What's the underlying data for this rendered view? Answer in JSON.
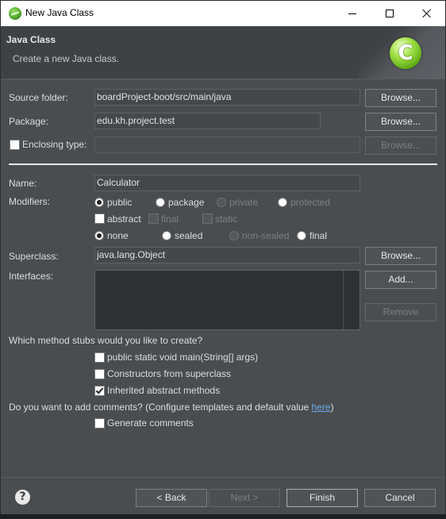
{
  "window": {
    "title": "New Java Class",
    "minimize_label": "",
    "maximize_label": "",
    "close_label": ""
  },
  "header": {
    "title": "Java Class",
    "subtitle": "Create a new Java class.",
    "badge_letter": "C"
  },
  "source_folder": {
    "label": "Source folder:",
    "value": "boardProject-boot/src/main/java",
    "browse": "Browse..."
  },
  "package": {
    "label": "Package:",
    "value": "edu.kh.project.test",
    "browse": "Browse..."
  },
  "enclosing_type": {
    "label": "Enclosing type:",
    "value": "",
    "checked": false,
    "browse": "Browse..."
  },
  "name": {
    "label": "Name:",
    "value": "Calculator"
  },
  "modifiers": {
    "label": "Modifiers:",
    "access": [
      {
        "label": "public",
        "selected": true,
        "enabled": true
      },
      {
        "label": "package",
        "selected": false,
        "enabled": true
      },
      {
        "label": "private",
        "selected": false,
        "enabled": false
      },
      {
        "label": "protected",
        "selected": false,
        "enabled": false
      }
    ],
    "flags": [
      {
        "label": "abstract",
        "checked": false,
        "enabled": true
      },
      {
        "label": "final",
        "checked": false,
        "enabled": false
      },
      {
        "label": "static",
        "checked": false,
        "enabled": false
      }
    ],
    "sealing": [
      {
        "label": "none",
        "selected": true,
        "enabled": true
      },
      {
        "label": "sealed",
        "selected": false,
        "enabled": true
      },
      {
        "label": "non-sealed",
        "selected": false,
        "enabled": false
      },
      {
        "label": "final",
        "selected": false,
        "enabled": true
      }
    ]
  },
  "superclass": {
    "label": "Superclass:",
    "value": "java.lang.Object",
    "browse": "Browse..."
  },
  "interfaces": {
    "label": "Interfaces:",
    "items": [],
    "add": "Add...",
    "remove": "Remove"
  },
  "stubs": {
    "question": "Which method stubs would you like to create?",
    "options": [
      {
        "label": "public static void main(String[] args)",
        "checked": false
      },
      {
        "label": "Constructors from superclass",
        "checked": false
      },
      {
        "label": "Inherited abstract methods",
        "checked": true
      }
    ]
  },
  "comments": {
    "question_prefix": "Do you want to add comments? (Configure templates and default value ",
    "link": "here",
    "question_suffix": ")",
    "generate_label": "Generate comments",
    "generate_checked": false
  },
  "footer": {
    "help": "?",
    "back": "< Back",
    "next": "Next >",
    "finish": "Finish",
    "cancel": "Cancel"
  }
}
